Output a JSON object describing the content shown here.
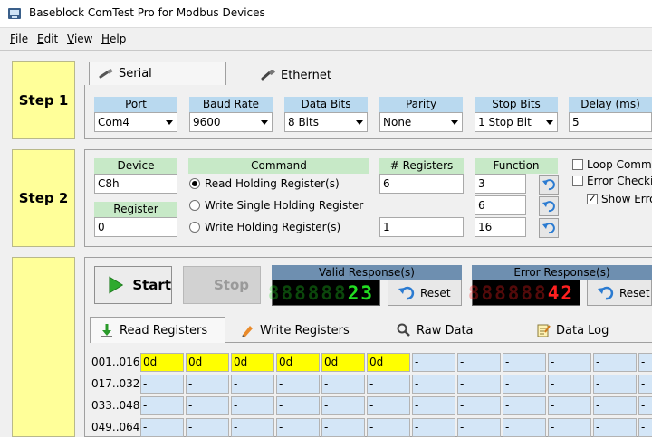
{
  "window": {
    "title": "Baseblock ComTest Pro for Modbus Devices"
  },
  "menu": [
    {
      "label": "File"
    },
    {
      "label": "Edit"
    },
    {
      "label": "View"
    },
    {
      "label": "Help"
    }
  ],
  "step1": {
    "label": "Step 1",
    "tabs": [
      {
        "label": "Serial",
        "active": true
      },
      {
        "label": "Ethernet",
        "active": false
      }
    ],
    "port": {
      "label": "Port",
      "value": "Com4"
    },
    "baud": {
      "label": "Baud Rate",
      "value": "9600"
    },
    "databits": {
      "label": "Data Bits",
      "value": "8 Bits"
    },
    "parity": {
      "label": "Parity",
      "value": "None"
    },
    "stopbits": {
      "label": "Stop Bits",
      "value": "1 Stop Bit"
    },
    "delay": {
      "label": "Delay (ms)",
      "value": "5"
    }
  },
  "step2": {
    "label": "Step 2",
    "device": {
      "label": "Device",
      "value": "C8h"
    },
    "register": {
      "label": "Register",
      "value": "0"
    },
    "command": {
      "label": "Command",
      "options": [
        {
          "label": "Read Holding Register(s)",
          "selected": true
        },
        {
          "label": "Write Single Holding Register",
          "selected": false
        },
        {
          "label": "Write Holding Register(s)",
          "selected": false
        }
      ]
    },
    "num_registers": {
      "label": "# Registers",
      "values": [
        "6",
        "1"
      ]
    },
    "function": {
      "label": "Function",
      "values": [
        "3",
        "6",
        "16"
      ]
    },
    "options": [
      {
        "label": "Loop Comma",
        "checked": false
      },
      {
        "label": "Error Checki",
        "checked": false
      },
      {
        "label": "Show Erro",
        "checked": true
      }
    ]
  },
  "step3": {
    "start_label": "Start",
    "stop_label": "Stop",
    "valid": {
      "label": "Valid Response(s)",
      "ghost": "888888",
      "value": "23"
    },
    "error": {
      "label": "Error Response(s)",
      "ghost": "888888",
      "value": "42"
    },
    "reset_label": "Reset",
    "tabs": [
      {
        "label": "Read Registers",
        "active": true
      },
      {
        "label": "Write Registers",
        "active": false
      },
      {
        "label": "Raw Data",
        "active": false
      },
      {
        "label": "Data Log",
        "active": false
      }
    ],
    "rows": [
      {
        "label": "001..016:",
        "cells": [
          "0d",
          "0d",
          "0d",
          "0d",
          "0d",
          "0d",
          "-",
          "-",
          "-",
          "-",
          "-",
          "-"
        ]
      },
      {
        "label": "017..032:",
        "cells": [
          "-",
          "-",
          "-",
          "-",
          "-",
          "-",
          "-",
          "-",
          "-",
          "-",
          "-",
          "-"
        ]
      },
      {
        "label": "033..048:",
        "cells": [
          "-",
          "-",
          "-",
          "-",
          "-",
          "-",
          "-",
          "-",
          "-",
          "-",
          "-",
          "-"
        ]
      },
      {
        "label": "049..064:",
        "cells": [
          "-",
          "-",
          "-",
          "-",
          "-",
          "-",
          "-",
          "-",
          "-",
          "-",
          "-",
          "-"
        ]
      }
    ]
  },
  "colors": {
    "step_bg": "#ffff99",
    "label_green": "#c7e9c7",
    "label_blue": "#b9d9ef",
    "cell_bg": "#d4e6f7",
    "cell_highlight": "#ffff00",
    "valid_digits": "#22dd22",
    "error_digits": "#ff2020"
  }
}
